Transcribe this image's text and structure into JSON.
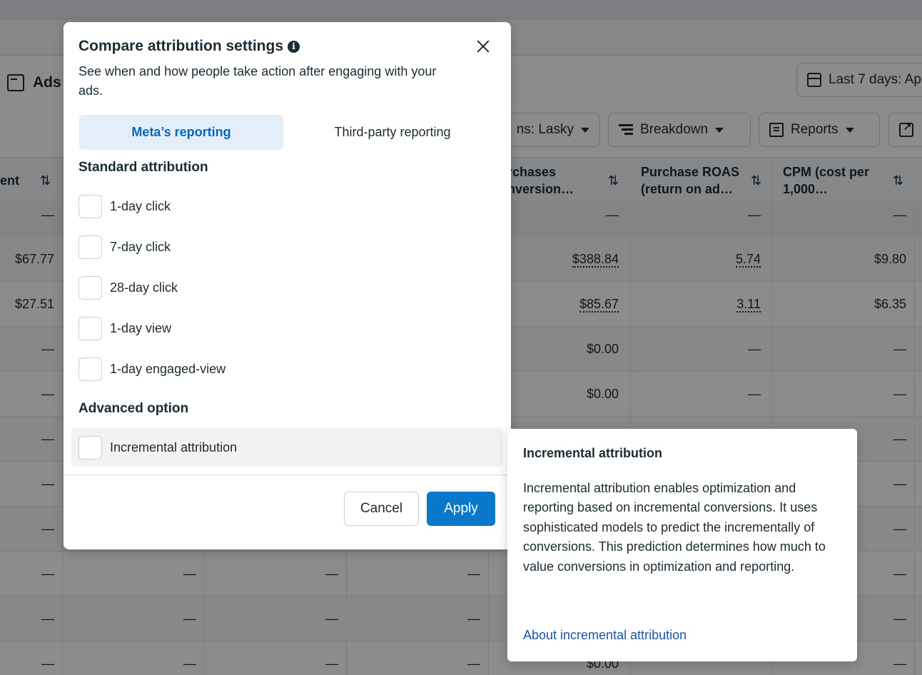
{
  "background": {
    "ads_title": "Ads",
    "date_range": "Last 7 days: Ap",
    "buttons": {
      "columns": "ns: Lasky",
      "breakdown": "Breakdown",
      "reports": "Reports"
    },
    "columns": [
      "ent",
      "urchases onversion…",
      "Purchase ROAS (return on ad…",
      "CPM (cost per 1,000…"
    ],
    "rows": [
      {
        "c0": "—",
        "c1": "—",
        "c2": "—",
        "c3": "—"
      },
      {
        "c0": "$67.77",
        "c1": "$388.84",
        "c2": "5.74",
        "c3": "$9.80"
      },
      {
        "c0": "$27.51",
        "c1": "$85.67",
        "c2": "3.11",
        "c3": "$6.35"
      },
      {
        "c0": "—",
        "c1": "$0.00",
        "c2": "—",
        "c3": "—"
      },
      {
        "c0": "—",
        "c1": "$0.00",
        "c2": "—",
        "c3": "—"
      },
      {
        "c0": "—",
        "c1": "",
        "c2": "",
        "c3": "—"
      },
      {
        "c0": "—",
        "c1": "",
        "c2": "",
        "c3": "—"
      },
      {
        "c0": "—",
        "c1": "",
        "c2": "",
        "c3": "—"
      },
      {
        "c0": "—",
        "c1": "—",
        "c2": "",
        "c3": "—"
      },
      {
        "c0": "—",
        "c1": "—",
        "c2": "",
        "c3": "—"
      },
      {
        "c0": "—",
        "c1": "$0.00",
        "c2": "",
        "c3": "—"
      }
    ],
    "extra_dash": "—"
  },
  "modal": {
    "title": "Compare attribution settings",
    "subtitle": "See when and how people take action after engaging with your ads.",
    "tabs": {
      "meta": "Meta’s reporting",
      "third_party": "Third-party reporting"
    },
    "standard_heading": "Standard attribution",
    "options": [
      "1-day click",
      "7-day click",
      "28-day click",
      "1-day view",
      "1-day engaged-view"
    ],
    "advanced_heading": "Advanced option",
    "advanced_option": "Incremental attribution",
    "cancel": "Cancel",
    "apply": "Apply"
  },
  "tooltip": {
    "title": "Incremental attribution",
    "body": "Incremental attribution enables optimization and reporting based on incremental conversions. It uses sophisticated models to predict the incrementally of conversions. This prediction determines how much to value conversions in optimization and reporting.",
    "link": "About incremental attribution"
  }
}
